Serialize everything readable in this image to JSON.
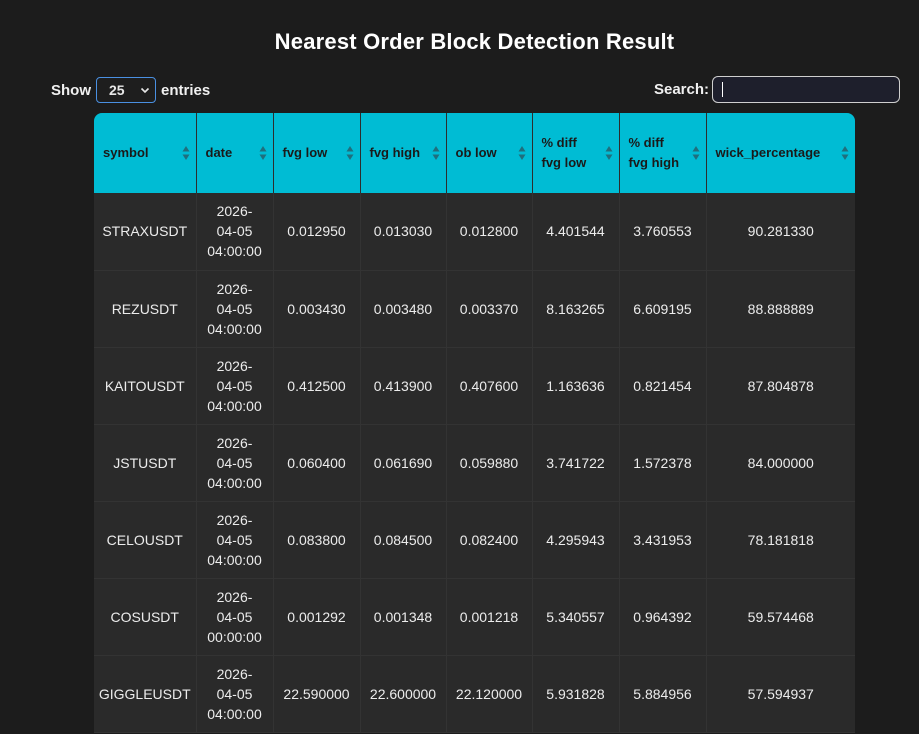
{
  "page": {
    "title": "Nearest Order Block Detection Result"
  },
  "length_control": {
    "show_label": "Show",
    "selected": "25",
    "entries_label": "entries"
  },
  "search": {
    "label": "Search:",
    "value": ""
  },
  "table": {
    "headers": [
      "symbol",
      "date",
      "fvg low",
      "fvg high",
      "ob low",
      "% diff fvg low",
      "% diff fvg high",
      "wick_percentage"
    ],
    "rows": [
      [
        "STRAXUSDT",
        "2026-04-05 04:00:00",
        "0.012950",
        "0.013030",
        "0.012800",
        "4.401544",
        "3.760553",
        "90.281330"
      ],
      [
        "REZUSDT",
        "2026-04-05 04:00:00",
        "0.003430",
        "0.003480",
        "0.003370",
        "8.163265",
        "6.609195",
        "88.888889"
      ],
      [
        "KAITOUSDT",
        "2026-04-05 04:00:00",
        "0.412500",
        "0.413900",
        "0.407600",
        "1.163636",
        "0.821454",
        "87.804878"
      ],
      [
        "JSTUSDT",
        "2026-04-05 04:00:00",
        "0.060400",
        "0.061690",
        "0.059880",
        "3.741722",
        "1.572378",
        "84.000000"
      ],
      [
        "CELOUSDT",
        "2026-04-05 04:00:00",
        "0.083800",
        "0.084500",
        "0.082400",
        "4.295943",
        "3.431953",
        "78.181818"
      ],
      [
        "COSUSDT",
        "2026-04-05 00:00:00",
        "0.001292",
        "0.001348",
        "0.001218",
        "5.340557",
        "0.964392",
        "59.574468"
      ],
      [
        "GIGGLEUSDT",
        "2026-04-05 04:00:00",
        "22.590000",
        "22.600000",
        "22.120000",
        "5.931828",
        "5.884956",
        "57.594937"
      ]
    ]
  },
  "colors": {
    "header_bg": "#00bcd4",
    "page_bg": "#1c1c1c",
    "cell_bg": "#2a2a2a"
  },
  "icons": {
    "sort": "sort-both-icon",
    "select": "chevron-down-icon"
  }
}
